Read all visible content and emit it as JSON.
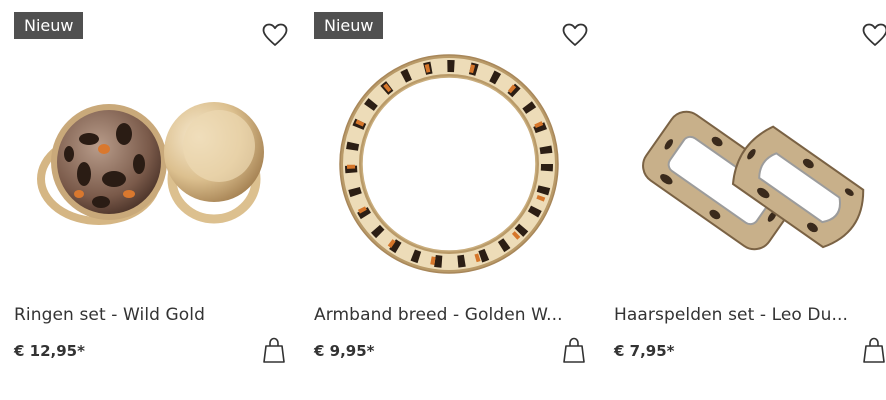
{
  "products": [
    {
      "badge": "Nieuw",
      "name": "Ringen set - Wild Gold",
      "price": "€ 12,95*",
      "wishlist_icon": "heart-icon",
      "cart_icon": "shopping-bag-icon"
    },
    {
      "badge": "Nieuw",
      "name": "Armband breed - Golden W...",
      "price": "€ 9,95*",
      "wishlist_icon": "heart-icon",
      "cart_icon": "shopping-bag-icon"
    },
    {
      "badge": "",
      "name": "Haarspelden set - Leo Du...",
      "price": "€ 7,95*",
      "wishlist_icon": "heart-icon",
      "cart_icon": "shopping-bag-icon"
    }
  ],
  "colors": {
    "badge_bg": "#505050",
    "text": "#333333",
    "gold": "#d9b98a",
    "leopard_dark": "#3a2a1c"
  }
}
